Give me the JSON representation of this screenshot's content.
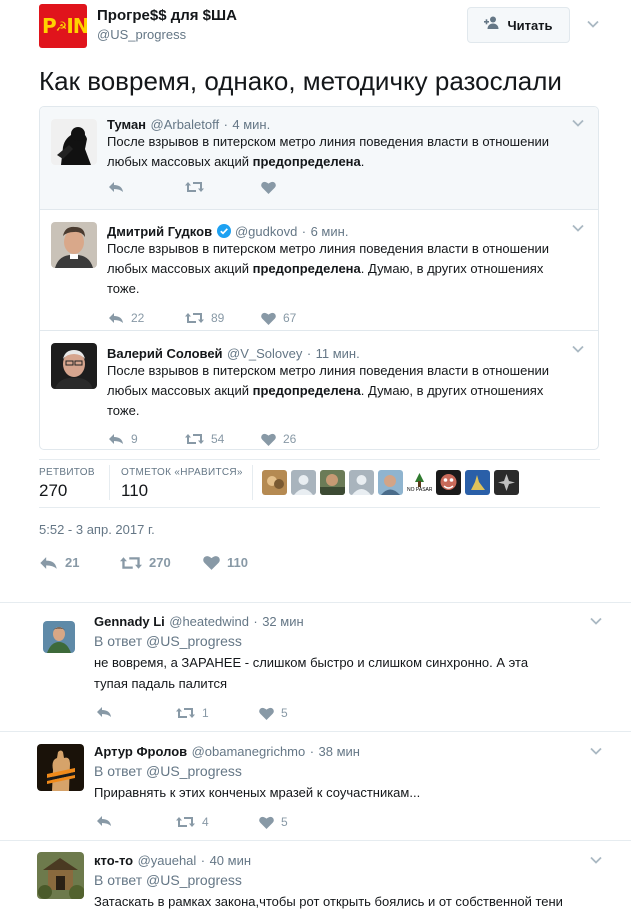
{
  "author": {
    "logo_text": "P",
    "logo_text2": "IN",
    "name": "Прогре$$ для $ША",
    "handle": "@US_progress",
    "follow_label": "Читать"
  },
  "tweet_text": "Как вовремя, однако, методичку разослали",
  "quotes": [
    {
      "name": "Туман",
      "handle": "@Arbaletoff",
      "time": "4 мин.",
      "text_1": "После взрывов в питерском метро линия поведения власти в отношении",
      "text_2a": "любых массовых акций ",
      "text_2b": "предопределена",
      "text_2c": ".",
      "text_3": "",
      "replies": "",
      "retweets": "",
      "likes": ""
    },
    {
      "name": "Дмитрий Гудков",
      "handle": "@gudkovd",
      "time": "6 мин.",
      "text_1": "После взрывов в питерском метро линия поведения власти в отношении",
      "text_2a": "любых массовых акций ",
      "text_2b": "предопределена",
      "text_2c": ". Думаю, в других отношениях",
      "text_3": "тоже.",
      "replies": "22",
      "retweets": "89",
      "likes": "67"
    },
    {
      "name": "Валерий Соловей",
      "handle": "@V_Solovey",
      "time": "11 мин.",
      "text_1": "После взрывов в питерском метро линия поведения власти в отношении",
      "text_2a": "любых массовых акций ",
      "text_2b": "предопределена",
      "text_2c": ". Думаю, в других отношениях",
      "text_3": "тоже.",
      "replies": "9",
      "retweets": "54",
      "likes": "26"
    }
  ],
  "stats": {
    "retweets_label": "РЕТВИТОВ",
    "retweets_value": "270",
    "likes_label": "ОТМЕТОК «НРАВИТСЯ»",
    "likes_value": "110",
    "thumb_caption": "NO PASARAN"
  },
  "timestamp": "5:52 - 3 апр. 2017 г.",
  "main_actions": {
    "replies": "21",
    "retweets": "270",
    "likes": "110"
  },
  "replies": [
    {
      "name": "Gennady Li",
      "handle": "@heatedwind",
      "time": "32 мин",
      "reply_to": "В ответ @US_progress",
      "text_1": "не вовремя, а ЗАРАНЕЕ - слишком быстро и слишком синхронно. А эта",
      "text_2": "тупая падаль палится",
      "replies": "",
      "retweets": "1",
      "likes": "5"
    },
    {
      "name": "Артур Фролов",
      "handle": "@obamanegrichmo",
      "time": "38 мин",
      "reply_to": "В ответ @US_progress",
      "text_1": "Приравнять к этих конченых мразей к соучастникам...",
      "text_2": "",
      "replies": "",
      "retweets": "4",
      "likes": "5"
    },
    {
      "name": "кто-то",
      "handle": "@yauehal",
      "time": "40 мин",
      "reply_to": "В ответ @US_progress",
      "text_1": "Затаскать в рамках закона,чтобы рот открыть боялись и от собственной тени",
      "text_2": "",
      "replies": "",
      "retweets": "",
      "likes": ""
    }
  ],
  "colors": {
    "accent": "#1da1f2",
    "gray": "#657786",
    "icon": "#8899a6",
    "border": "#e1e8ed",
    "logo_bg": "#e0141c",
    "logo_fg": "#ffd200"
  }
}
